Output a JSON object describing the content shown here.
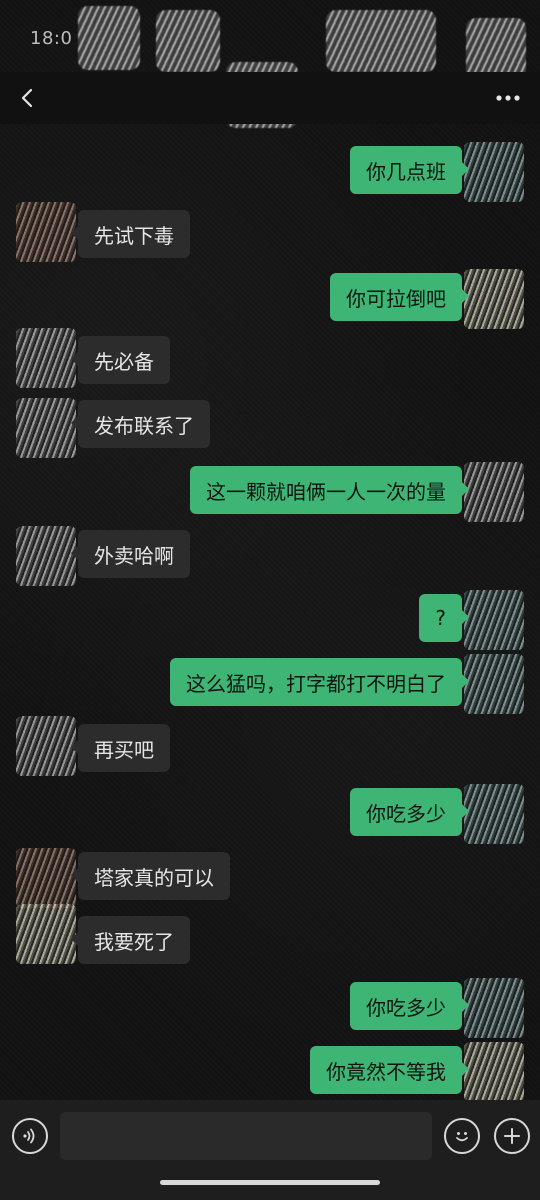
{
  "status_bar": {
    "time": "18:0"
  },
  "nav": {
    "title": "",
    "back_icon": "chevron-left-icon",
    "more_icon": "more-dots-icon"
  },
  "messages": [
    {
      "side": "right",
      "text": "你几点班"
    },
    {
      "side": "left",
      "text": "先试下毒"
    },
    {
      "side": "right",
      "text": "你可拉倒吧"
    },
    {
      "side": "left",
      "text": "先必备"
    },
    {
      "side": "left",
      "text": "发布联系了"
    },
    {
      "side": "right",
      "text": "这一颗就咱俩一人一次的量"
    },
    {
      "side": "left",
      "text": "外卖哈啊"
    },
    {
      "side": "right",
      "text": "?"
    },
    {
      "side": "right",
      "text": "这么猛吗，打字都打不明白了"
    },
    {
      "side": "left",
      "text": "再买吧"
    },
    {
      "side": "right",
      "text": "你吃多少"
    },
    {
      "side": "left",
      "text": "塔家真的可以"
    },
    {
      "side": "left",
      "text": "我要死了"
    },
    {
      "side": "right",
      "text": "你吃多少"
    },
    {
      "side": "right",
      "text": "你竟然不等我"
    }
  ],
  "input_bar": {
    "placeholder": "",
    "voice_icon": "voice-icon",
    "emoji_icon": "emoji-icon",
    "plus_icon": "plus-icon"
  },
  "colors": {
    "sent_bubble": "#3eb575",
    "received_bubble": "#2c2c2c",
    "background": "#121212"
  }
}
